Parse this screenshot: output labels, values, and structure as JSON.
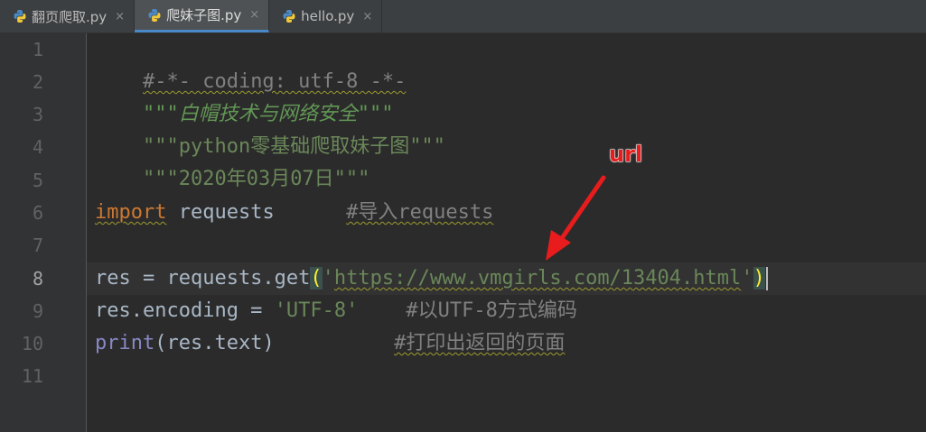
{
  "tabs": [
    {
      "label": "翻页爬取.py",
      "close": "×"
    },
    {
      "label": "爬妹子图.py",
      "close": "×"
    },
    {
      "label": "hello.py",
      "close": "×"
    }
  ],
  "line_numbers": [
    "1",
    "2",
    "3",
    "4",
    "5",
    "6",
    "7",
    "8",
    "9",
    "10",
    "11"
  ],
  "current_line": 8,
  "code": {
    "l1": "#-*- coding: utf-8 -*-",
    "l2": "\"\"\"白帽技术与网络安全\"\"\"",
    "l3": "\"\"\"python零基础爬取妹子图\"\"\"",
    "l4": "\"\"\"2020年03月07日\"\"\"",
    "l6_kw": "import",
    "l6_mod": " requests      ",
    "l6_cmt": "#导入requests",
    "l8_pre": "res = requests.get",
    "l8_open": "(",
    "l8_str_q1": "'",
    "l8_url": "https://www.vmgirls.com/13404.html",
    "l8_str_q2": "'",
    "l8_close": ")",
    "l9_code": "res.encoding = ",
    "l9_str": "'UTF-8'",
    "l9_pad": "    ",
    "l9_cmt": "#以UTF-8方式编码",
    "l10_fn": "print",
    "l10_rest": "(res.text)          ",
    "l10_cmt": "#打印出返回的页面"
  },
  "annotation": {
    "label": "url",
    "color": "#e81c1c"
  },
  "colors": {
    "background": "#2b2b2b",
    "keyword": "#cc7832",
    "string": "#6a8759",
    "comment": "#808080",
    "docstring": "#629755"
  },
  "icons": [
    "python-file-icon",
    "close-icon",
    "arrow-annotation"
  ]
}
